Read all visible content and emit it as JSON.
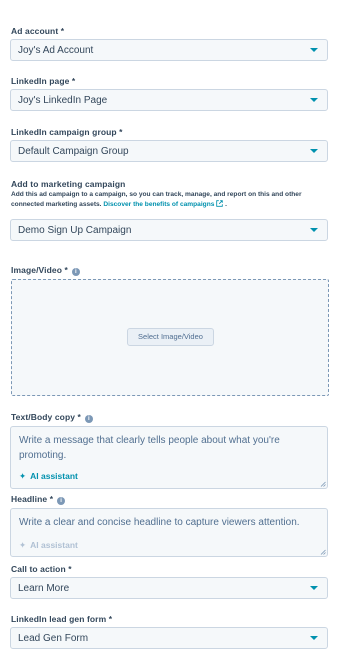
{
  "fields": {
    "ad_account": {
      "label": "Ad account *",
      "value": "Joy's Ad Account"
    },
    "linkedin_page": {
      "label": "LinkedIn page *",
      "value": "Joy's LinkedIn Page"
    },
    "campaign_group": {
      "label": "LinkedIn campaign group *",
      "value": "Default Campaign Group"
    },
    "marketing_campaign": {
      "label": "Add to marketing campaign",
      "help_text": "Add this ad campaign to a campaign, so you can track, manage, and report on this and other connected marketing assets.",
      "help_link": "Discover the benefits of campaigns",
      "help_suffix": ".",
      "value": "Demo Sign Up Campaign"
    },
    "image_video": {
      "label": "Image/Video *",
      "button": "Select Image/Video"
    },
    "body_copy": {
      "label": "Text/Body copy *",
      "placeholder": "Write a message that clearly tells people about what you're promoting.",
      "ai_label": "AI assistant"
    },
    "headline": {
      "label": "Headline *",
      "placeholder": "Write a clear and concise headline to capture viewers attention.",
      "ai_label": "AI assistant"
    },
    "call_to_action": {
      "label": "Call to action *",
      "value": "Learn More"
    },
    "lead_gen_form": {
      "label": "LinkedIn lead gen form *",
      "value": "Lead Gen Form"
    }
  },
  "icons": {
    "info": "info-icon",
    "dropdown": "chevron-down-icon",
    "external": "external-link-icon",
    "sparkle": "sparkle-icon",
    "resize": "resize-handle-icon"
  },
  "colors": {
    "accent": "#0091ae",
    "text": "#33475b",
    "field_bg": "#f5f8fa",
    "border": "#cbd6e2"
  }
}
